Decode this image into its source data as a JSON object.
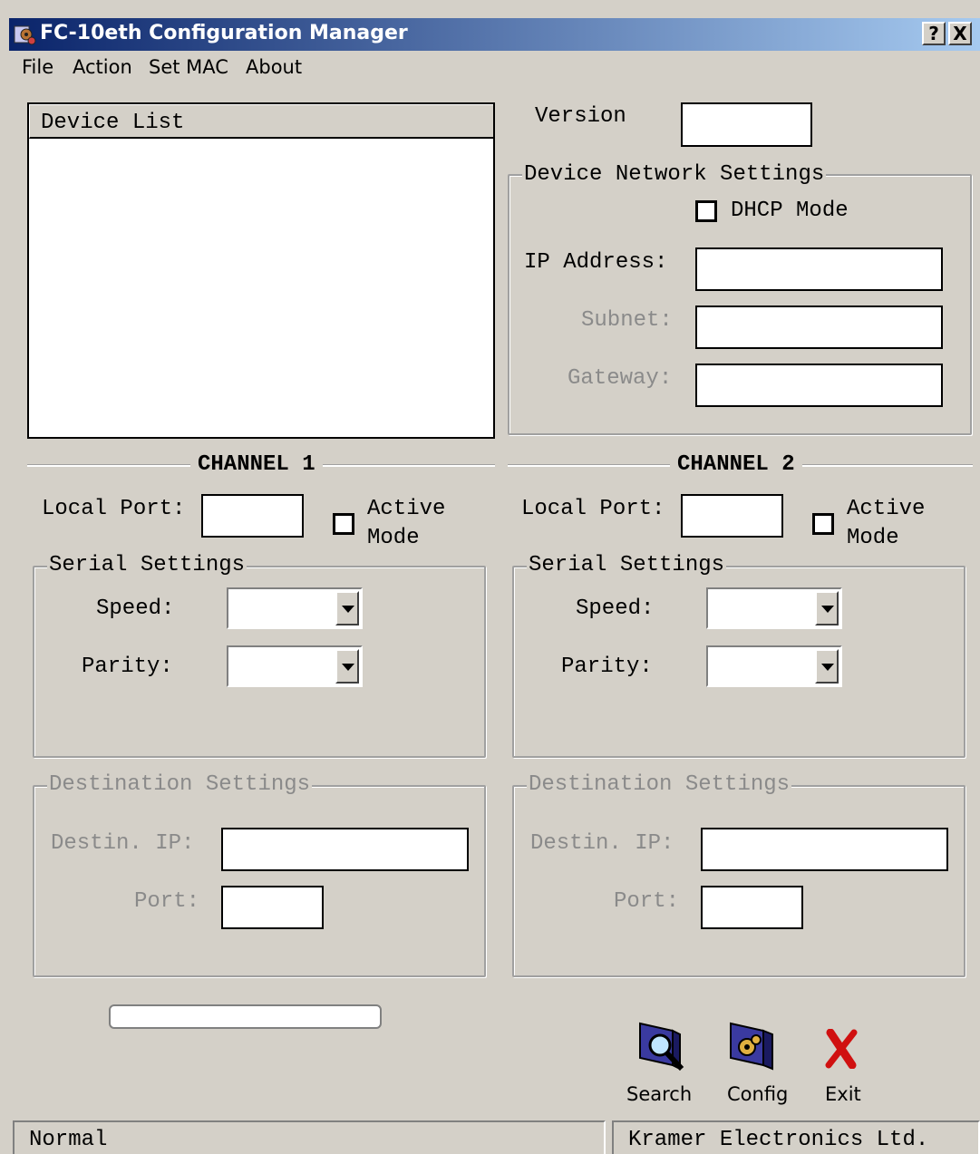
{
  "window": {
    "title": "FC-10eth Configuration Manager",
    "help_btn": "?",
    "close_btn": "X"
  },
  "menu": {
    "file": "File",
    "action": "Action",
    "set_mac": "Set MAC",
    "about": "About"
  },
  "device_list": {
    "header": "Device List"
  },
  "version": {
    "label": "Version",
    "value": ""
  },
  "network": {
    "legend": "Device Network Settings",
    "dhcp_label": "DHCP Mode",
    "ip_label": "IP Address:",
    "subnet_label": "Subnet:",
    "gateway_label": "Gateway:",
    "ip_value": "",
    "subnet_value": "",
    "gateway_value": ""
  },
  "channels": [
    {
      "title": "CHANNEL 1",
      "local_port_label": "Local Port:",
      "local_port_value": "",
      "active_label_1": "Active",
      "active_label_2": "Mode",
      "serial_legend": "Serial Settings",
      "speed_label": "Speed:",
      "parity_label": "Parity:",
      "dest_legend": "Destination Settings",
      "dest_ip_label": "Destin. IP:",
      "port_label": "Port:"
    },
    {
      "title": "CHANNEL 2",
      "local_port_label": "Local Port:",
      "local_port_value": "",
      "active_label_1": "Active",
      "active_label_2": "Mode",
      "serial_legend": "Serial Settings",
      "speed_label": "Speed:",
      "parity_label": "Parity:",
      "dest_legend": "Destination Settings",
      "dest_ip_label": "Destin. IP:",
      "port_label": "Port:"
    }
  ],
  "progress": {
    "value": 0
  },
  "buttons": {
    "search": "Search",
    "config": "Config",
    "exit": "Exit"
  },
  "status": {
    "left": "Normal",
    "right": "Kramer Electronics Ltd."
  },
  "icons": {
    "app": "app-gear-icon",
    "search": "magnifier-monitor-icon",
    "config": "gear-monitor-icon",
    "exit": "red-x-icon"
  }
}
